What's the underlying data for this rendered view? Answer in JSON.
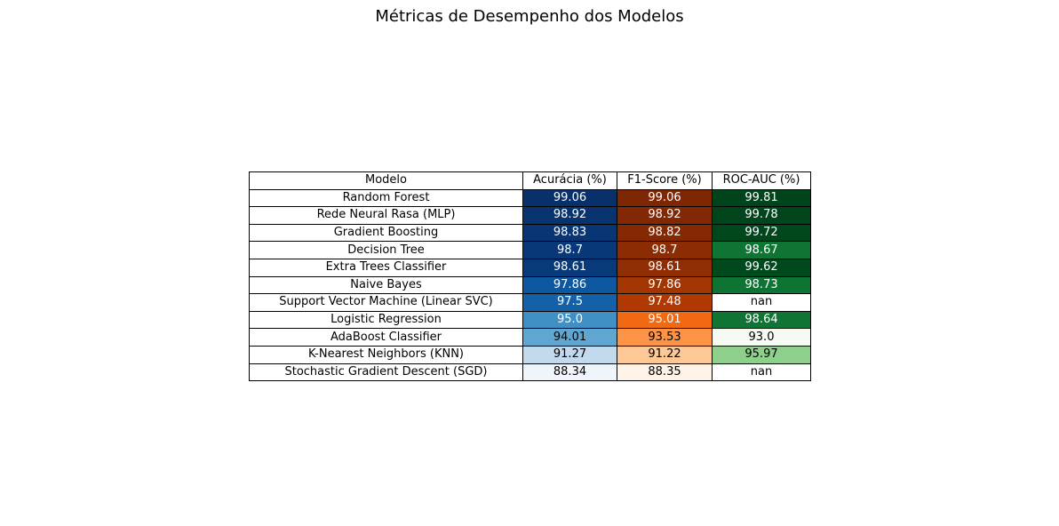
{
  "title": "Métricas de Desempenho dos Modelos",
  "chart_data": {
    "type": "table",
    "title": "Métricas de Desempenho dos Modelos",
    "columns": [
      "Modelo",
      "Acurácia (%)",
      "F1-Score (%)",
      "ROC-AUC (%)"
    ],
    "rows": [
      [
        "Random Forest",
        "99.06",
        "99.06",
        "99.81"
      ],
      [
        "Rede Neural Rasa (MLP)",
        "98.92",
        "98.92",
        "99.78"
      ],
      [
        "Gradient Boosting",
        "98.83",
        "98.82",
        "99.72"
      ],
      [
        "Decision Tree",
        "98.7",
        "98.7",
        "98.67"
      ],
      [
        "Extra Trees Classifier",
        "98.61",
        "98.61",
        "99.62"
      ],
      [
        "Naive Bayes",
        "97.86",
        "97.86",
        "98.73"
      ],
      [
        "Support Vector Machine (Linear SVC)",
        "97.5",
        "97.48",
        "nan"
      ],
      [
        "Logistic Regression",
        "95.0",
        "95.01",
        "98.64"
      ],
      [
        "AdaBoost Classifier",
        "94.01",
        "93.53",
        "93.0"
      ],
      [
        "K-Nearest Neighbors (KNN)",
        "91.27",
        "91.22",
        "95.97"
      ],
      [
        "Stochastic Gradient Descent (SGD)",
        "88.34",
        "88.35",
        "nan"
      ]
    ],
    "cell_colors": [
      [
        "#ffffff",
        "#08306b",
        "#7f2704",
        "#00441b"
      ],
      [
        "#ffffff",
        "#08336e",
        "#822804",
        "#00451c"
      ],
      [
        "#ffffff",
        "#083573",
        "#852904",
        "#00471d"
      ],
      [
        "#ffffff",
        "#083877",
        "#8b2c04",
        "#0f7534"
      ],
      [
        "#ffffff",
        "#083a7a",
        "#8f2d04",
        "#00491d"
      ],
      [
        "#ffffff",
        "#0e58a2",
        "#a33503",
        "#0e7433"
      ],
      [
        "#ffffff",
        "#1561a9",
        "#b03903",
        "#ffffff"
      ],
      [
        "#ffffff",
        "#4190c5",
        "#f16913",
        "#107534"
      ],
      [
        "#ffffff",
        "#5fa6d1",
        "#fd9346",
        "#f5fbf2"
      ],
      [
        "#ffffff",
        "#c3d9ee",
        "#fdc895",
        "#8ed08b"
      ],
      [
        "#ffffff",
        "#f0f5fc",
        "#fff2e6",
        "#ffffff"
      ]
    ],
    "text_colors": [
      [
        "#000000",
        "#ffffff",
        "#ffffff",
        "#ffffff"
      ],
      [
        "#000000",
        "#ffffff",
        "#ffffff",
        "#ffffff"
      ],
      [
        "#000000",
        "#ffffff",
        "#ffffff",
        "#ffffff"
      ],
      [
        "#000000",
        "#ffffff",
        "#ffffff",
        "#ffffff"
      ],
      [
        "#000000",
        "#ffffff",
        "#ffffff",
        "#ffffff"
      ],
      [
        "#000000",
        "#ffffff",
        "#ffffff",
        "#ffffff"
      ],
      [
        "#000000",
        "#ffffff",
        "#ffffff",
        "#000000"
      ],
      [
        "#000000",
        "#ffffff",
        "#ffffff",
        "#ffffff"
      ],
      [
        "#000000",
        "#000000",
        "#000000",
        "#000000"
      ],
      [
        "#000000",
        "#000000",
        "#000000",
        "#000000"
      ],
      [
        "#000000",
        "#000000",
        "#000000",
        "#000000"
      ]
    ],
    "colormaps": [
      "Blues",
      "Oranges",
      "Greens"
    ]
  }
}
